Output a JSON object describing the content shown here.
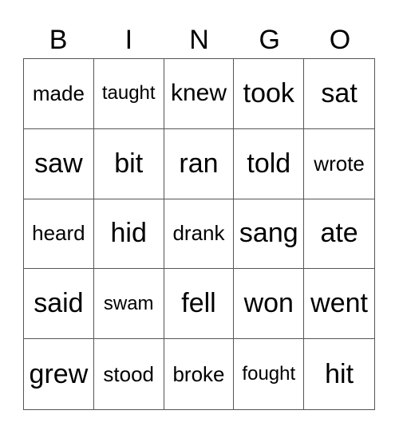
{
  "header": [
    "B",
    "I",
    "N",
    "G",
    "O"
  ],
  "cells": [
    "made",
    "taught",
    "knew",
    "took",
    "sat",
    "saw",
    "bit",
    "ran",
    "told",
    "wrote",
    "heard",
    "hid",
    "drank",
    "sang",
    "ate",
    "said",
    "swam",
    "fell",
    "won",
    "went",
    "grew",
    "stood",
    "broke",
    "fought",
    "hit"
  ]
}
